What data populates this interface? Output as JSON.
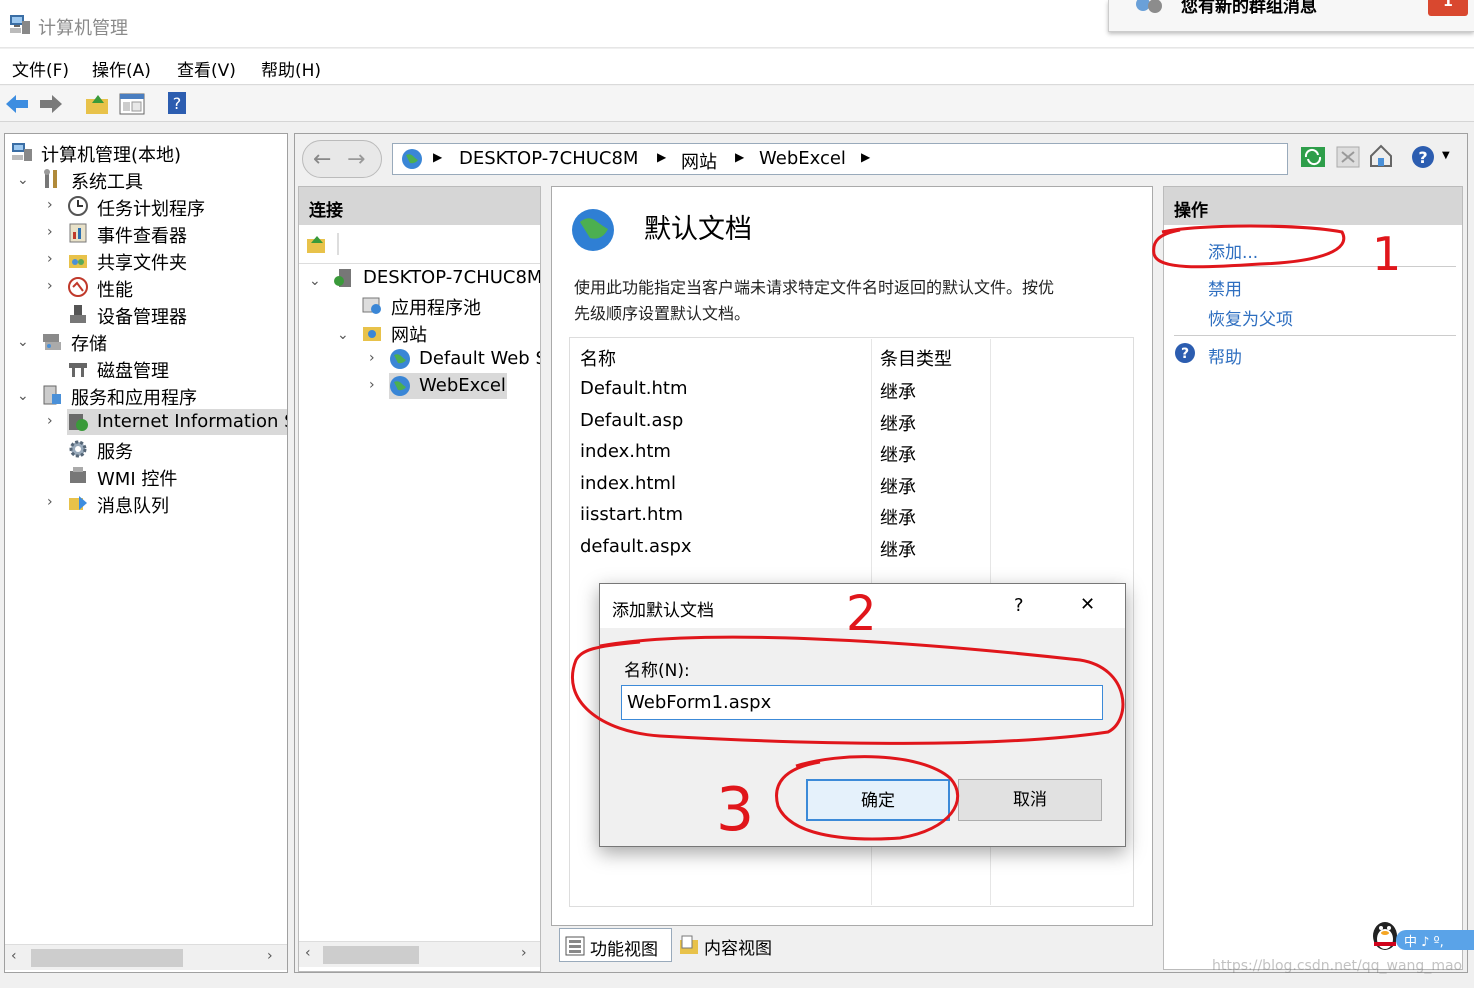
{
  "window": {
    "title": "计算机管理"
  },
  "notification": {
    "text": "您有新的群组消息",
    "badge": "1"
  },
  "menu": [
    "文件(F)",
    "操作(A)",
    "查看(V)",
    "帮助(H)"
  ],
  "tree": {
    "root": "计算机管理(本地)",
    "system_tools": "系统工具",
    "task_scheduler": "任务计划程序",
    "event_viewer": "事件查看器",
    "shared_folders": "共享文件夹",
    "performance": "性能",
    "device_manager": "设备管理器",
    "storage": "存储",
    "disk_management": "磁盘管理",
    "services_apps": "服务和应用程序",
    "iis": "Internet Information Se",
    "services": "服务",
    "wmi": "WMI 控件",
    "message_queue": "消息队列"
  },
  "breadcrumb": [
    "DESKTOP-7CHUC8M",
    "网站",
    "WebExcel"
  ],
  "connections": {
    "header": "连接",
    "server": "DESKTOP-7CHUC8M",
    "app_pools": "应用程序池",
    "sites": "网站",
    "default_site": "Default Web S",
    "webexcel": "WebExcel"
  },
  "feature": {
    "title": "默认文档",
    "description_line1": "使用此功能指定当客户端未请求特定文件名时返回的默认文件。按优",
    "description_line2": "先级顺序设置默认文档。",
    "col_name": "名称",
    "col_type": "条目类型",
    "rows": [
      {
        "name": "Default.htm",
        "type": "继承"
      },
      {
        "name": "Default.asp",
        "type": "继承"
      },
      {
        "name": "index.htm",
        "type": "继承"
      },
      {
        "name": "index.html",
        "type": "继承"
      },
      {
        "name": "iisstart.htm",
        "type": "继承"
      },
      {
        "name": "default.aspx",
        "type": "继承"
      }
    ]
  },
  "actions": {
    "header": "操作",
    "add": "添加...",
    "disable": "禁用",
    "revert": "恢复为父项",
    "help": "帮助"
  },
  "dialog": {
    "title": "添加默认文档",
    "help_glyph": "?",
    "close_glyph": "✕",
    "name_label": "名称(N):",
    "name_value": "WebForm1.aspx",
    "ok": "确定",
    "cancel": "取消"
  },
  "tabs": {
    "features_view": "功能视图",
    "content_view": "内容视图"
  },
  "annotations": [
    "1",
    "2",
    "3"
  ],
  "ime": {
    "text": "中 ♪ º,"
  },
  "watermark": "https://blog.csdn.net/qq_wang_mao",
  "colors": {
    "link": "#2f6fc0",
    "annotation": "#e0161b",
    "selection": "#cde8ff"
  }
}
